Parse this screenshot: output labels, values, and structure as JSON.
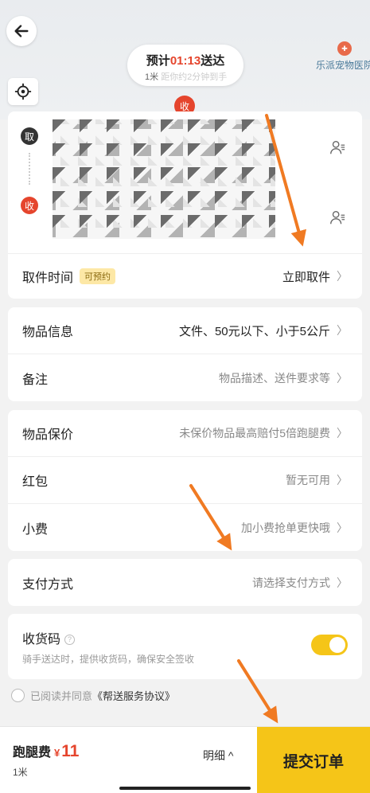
{
  "map": {
    "eta_prefix": "预计",
    "eta_time": "01:13",
    "eta_suffix": "送达",
    "distance": "1米",
    "distance_faded": "距你约2分钟到手",
    "poi_name": "乐派宠物医院",
    "shou_pin": "收"
  },
  "address": {
    "pickup_badge": "取",
    "dropoff_badge": "收"
  },
  "pickup_time": {
    "label": "取件时间",
    "tag": "可预约",
    "value": "立即取件"
  },
  "item_info": {
    "label": "物品信息",
    "value": "文件、50元以下、小于5公斤"
  },
  "remark": {
    "label": "备注",
    "placeholder": "物品描述、送件要求等"
  },
  "insurance": {
    "label": "物品保价",
    "value": "未保价物品最高赔付5倍跑腿费"
  },
  "red_packet": {
    "label": "红包",
    "value": "暂无可用"
  },
  "tip": {
    "label": "小费",
    "value": "加小费抢单更快哦"
  },
  "payment": {
    "label": "支付方式",
    "value": "请选择支付方式"
  },
  "receipt_code": {
    "label": "收货码",
    "help": "?",
    "desc": "骑手送达时，提供收货码，确保安全签收",
    "enabled": true
  },
  "agreement": {
    "prefix": "已阅读并同意",
    "link": "《帮送服务协议》"
  },
  "bottom": {
    "fee_label": "跑腿费",
    "currency": "¥",
    "amount": "11",
    "distance": "1米",
    "detail": "明细 ^",
    "submit": "提交订单"
  },
  "colors": {
    "accent": "#f5c518",
    "price": "#e5452d",
    "annotation": "#f07a22"
  }
}
